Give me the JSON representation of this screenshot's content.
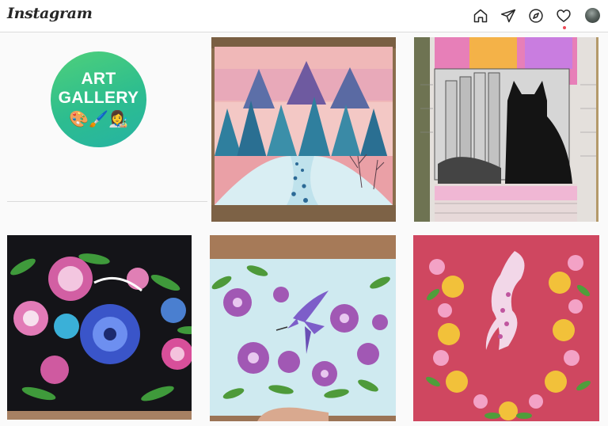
{
  "app": {
    "logo_text": "Instagram"
  },
  "nav": {
    "icons": [
      "home-icon",
      "direct-send-icon",
      "explore-compass-icon",
      "activity-heart-icon",
      "profile-avatar"
    ],
    "notification_dot_color": "#ed4956"
  },
  "highlight": {
    "line1": "ART",
    "line2": "GALLERY",
    "emoji": "🎨🖌️👩‍🎨",
    "gradient": [
      "#4fd07a",
      "#26b3a3"
    ]
  },
  "grid": {
    "posts": [
      {
        "subject": "winter forest painting with snowy path"
      },
      {
        "subject": "black cat drawing by window with fence"
      },
      {
        "subject": "decorative floral painting on black background"
      },
      {
        "subject": "hummingbird with purple flowers painting"
      },
      {
        "subject": "bird with floral border on red background"
      }
    ]
  },
  "colors": {
    "header_bg": "#ffffff",
    "page_bg": "#fafafa",
    "border": "#dbdbdb",
    "icon": "#262626"
  }
}
